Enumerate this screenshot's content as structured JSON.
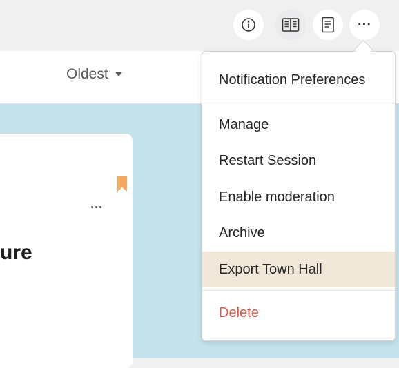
{
  "header": {
    "buttons": [
      {
        "name": "info-icon"
      },
      {
        "name": "reader-icon"
      },
      {
        "name": "document-icon"
      },
      {
        "name": "more-icon",
        "label": "···"
      }
    ]
  },
  "sort": {
    "label": "Oldest"
  },
  "card": {
    "title_fragment": "ure",
    "more_label": "···",
    "bookmark_color": "#f4a860"
  },
  "menu": {
    "items": [
      {
        "label": "Notification Preferences"
      },
      {
        "label": "Manage"
      },
      {
        "label": "Restart Session"
      },
      {
        "label": "Enable moderation"
      },
      {
        "label": "Archive"
      },
      {
        "label": "Export Town Hall",
        "highlighted": true
      },
      {
        "label": "Delete",
        "danger": true
      }
    ]
  },
  "colors": {
    "background": "#c3e2ea",
    "highlight": "#f1e8da",
    "danger": "#d95a4a",
    "bookmark": "#f4a860"
  }
}
